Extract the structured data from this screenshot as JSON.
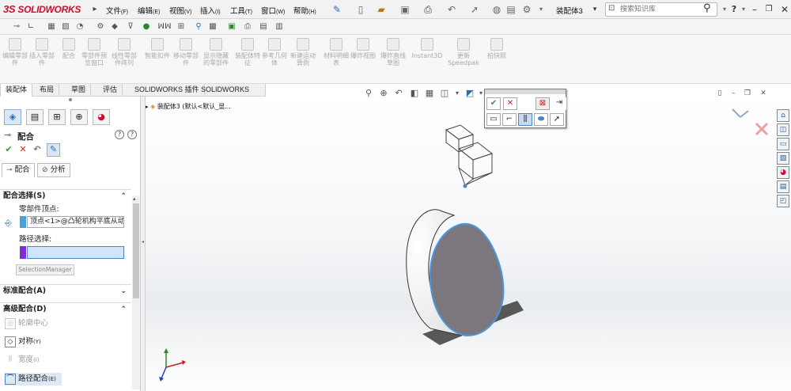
{
  "app": {
    "brand_ds": "3S",
    "brand_name": "SOLIDWORKS",
    "document_title": "装配体3"
  },
  "menu": [
    {
      "label": "文件",
      "key": "(F)"
    },
    {
      "label": "编辑",
      "key": "(E)"
    },
    {
      "label": "视图",
      "key": "(V)"
    },
    {
      "label": "插入",
      "key": "(I)"
    },
    {
      "label": "工具",
      "key": "(T)"
    },
    {
      "label": "窗口",
      "key": "(W)"
    },
    {
      "label": "帮助",
      "key": "(H)"
    }
  ],
  "search": {
    "placeholder": "搜索知识库"
  },
  "command_manager": [
    "编辑零部件",
    "插入零部件",
    "配合",
    "零部件预览窗口",
    "线性零部件阵列",
    "智能扣件",
    "移动零部件",
    "显示隐藏的零部件",
    "装配体特征",
    "参考几何体",
    "新建运动算例",
    "材料明细表",
    "爆炸视图",
    "爆炸直线草图",
    "Instant3D",
    "更新Speedpak",
    "拍快照"
  ],
  "tabs": [
    "装配体",
    "布局",
    "草图",
    "评估",
    "SOLIDWORKS 插件",
    "SOLIDWORKS MBD"
  ],
  "active_tab": "装配体",
  "property_manager": {
    "title": "配合",
    "subtabs": [
      "配合",
      "分析"
    ],
    "mate_selections": {
      "heading": "配合选择(S)",
      "vertex_label": "零部件顶点:",
      "vertex_value": "顶点<1>@凸轮机构平底从动",
      "path_label": "路径选择:",
      "selection_manager": "SelectionManager"
    },
    "standard_heading": "标准配合(A)",
    "advanced_heading": "高级配合(D)",
    "advanced_items": [
      {
        "label": "轮廓中心",
        "enabled": false
      },
      {
        "label": "对称",
        "key": "(Y)",
        "enabled": true
      },
      {
        "label": "宽度",
        "key": "(I)",
        "enabled": false
      },
      {
        "label": "路径配合",
        "key": "(E)",
        "enabled": true
      }
    ]
  },
  "feature_tree": {
    "root": "装配体3 (默认<默认_显..."
  },
  "colors": {
    "accent": "#4a86c5",
    "selection_purple": "#7c2fd8",
    "cam_face": "#7b777c",
    "brand_red": "#c8102e"
  }
}
